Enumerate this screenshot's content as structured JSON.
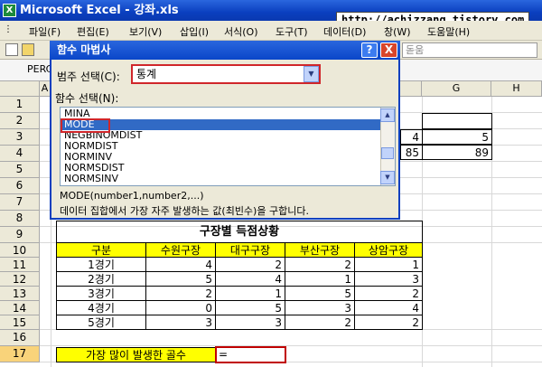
{
  "window": {
    "title": "Microsoft Excel - 강좌.xls",
    "logo": "X",
    "watermark": "http://achizzang.tistory.com"
  },
  "menu": [
    "파일(F)",
    "편집(E)",
    "보기(V)",
    "삽입(I)",
    "서식(O)",
    "도구(T)",
    "데이터(D)",
    "창(W)",
    "도움말(H)"
  ],
  "toolbar": {
    "font_placeholder": "돋움"
  },
  "namebox": "PERC",
  "columns": [
    "A",
    "G",
    "H"
  ],
  "rows": [
    "1",
    "2",
    "3",
    "4",
    "5",
    "6",
    "7",
    "8",
    "9",
    "10",
    "11",
    "12",
    "13",
    "14",
    "15",
    "16",
    "17"
  ],
  "dialog": {
    "title": "함수 마법사",
    "help": "?",
    "close": "X",
    "category_label": "범주 선택(C):",
    "category_value": "통계",
    "function_label": "함수 선택(N):",
    "functions": [
      "MINA",
      "MODE",
      "NEGBINOMDIST",
      "NORMDIST",
      "NORMINV",
      "NORMSDIST",
      "NORMSINV"
    ],
    "selected_function": "MODE",
    "syntax": "MODE(number1,number2,...)",
    "description": "데이터 집합에서 가장 자주 발생하는 값(최빈수)을 구합니다."
  },
  "sheet": {
    "partial": [
      {
        "row": "3",
        "f": "4",
        "g": "5"
      },
      {
        "row": "4",
        "f": "85",
        "g": "89"
      }
    ],
    "table_title": "구장별 득점상황",
    "headers": [
      "구분",
      "수원구장",
      "대구구장",
      "부산구장",
      "상암구장"
    ],
    "data": [
      [
        "1경기",
        "4",
        "2",
        "2",
        "1"
      ],
      [
        "2경기",
        "5",
        "4",
        "1",
        "3"
      ],
      [
        "3경기",
        "2",
        "1",
        "5",
        "2"
      ],
      [
        "4경기",
        "0",
        "5",
        "3",
        "4"
      ],
      [
        "5경기",
        "3",
        "3",
        "2",
        "2"
      ]
    ],
    "question_label": "가장 많이 발생한 골수",
    "formula": "="
  }
}
